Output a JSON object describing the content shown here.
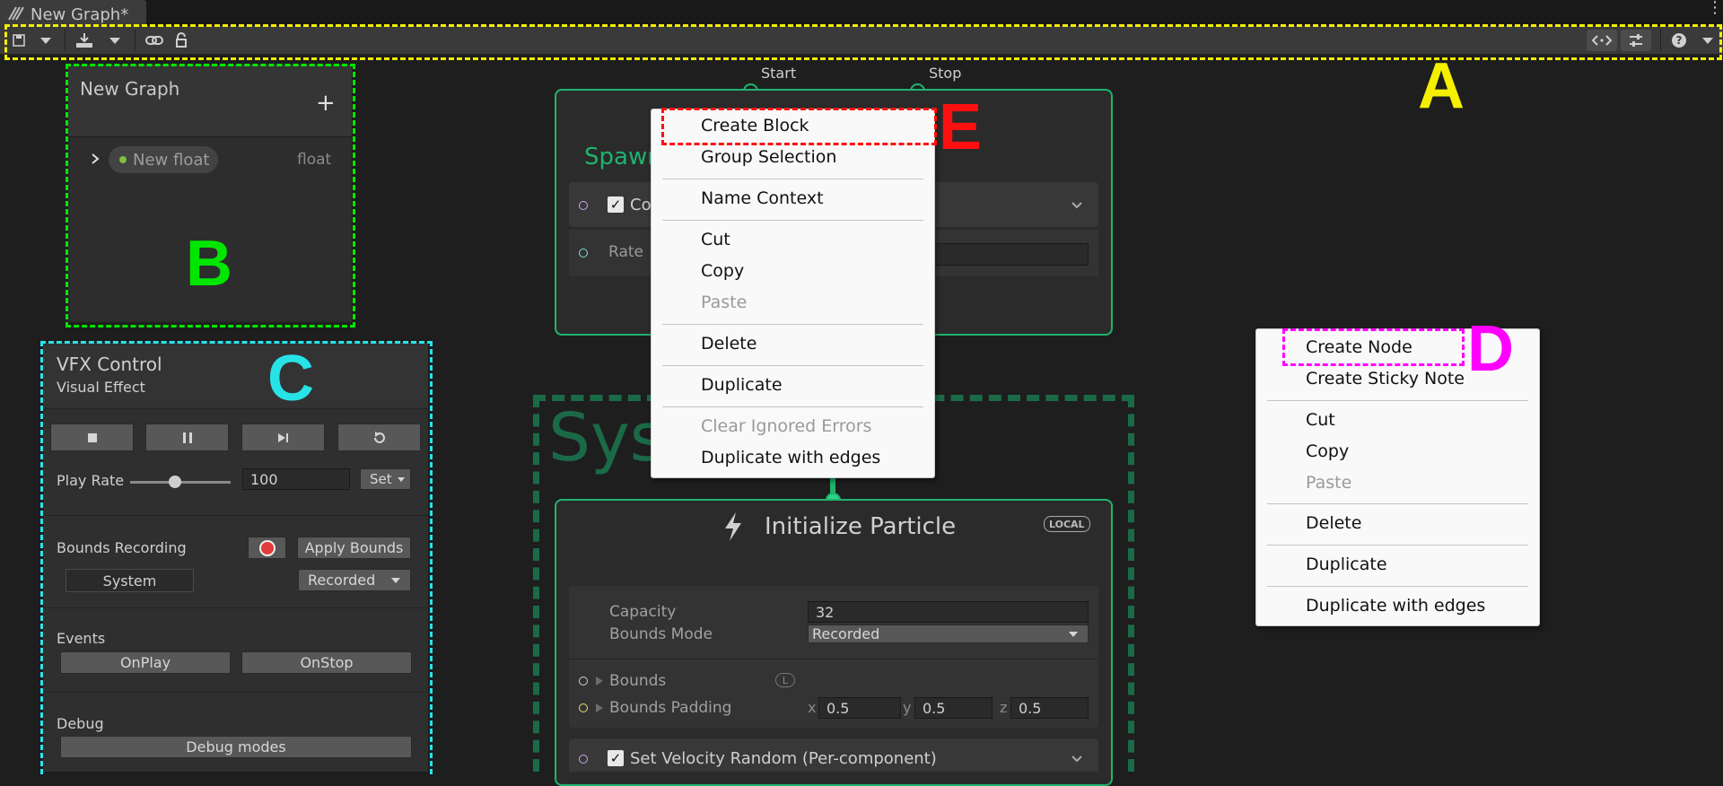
{
  "window": {
    "tab_title": "New Graph*"
  },
  "toolbar": {
    "icons": [
      "save-icon",
      "dropdown-icon",
      "import-icon",
      "dropdown-icon",
      "link-icon",
      "lock-icon",
      "code-toggle-icon",
      "settings-sliders-icon",
      "help-icon",
      "dropdown-icon"
    ]
  },
  "blackboard": {
    "title": "New Graph",
    "add_label": "+",
    "property": {
      "name": "New float",
      "type": "float"
    }
  },
  "vfx_control": {
    "title": "VFX Control",
    "subtitle": "Visual Effect",
    "play_rate_label": "Play Rate",
    "play_rate_value": "100",
    "play_rate_fraction": 0.45,
    "set_label": "Set",
    "bounds_recording_label": "Bounds Recording",
    "apply_bounds_label": "Apply Bounds",
    "system_label": "System",
    "recorded_label": "Recorded",
    "events_label": "Events",
    "onplay_label": "OnPlay",
    "onstop_label": "OnStop",
    "debug_label": "Debug",
    "debug_modes_label": "Debug modes"
  },
  "spawn_context": {
    "start_label": "Start",
    "stop_label": "Stop",
    "title_partial": "Spawn",
    "block_label_partial": "Co",
    "rate_label": "Rate"
  },
  "system": {
    "label_partial": "Sys"
  },
  "init_context": {
    "title": "Initialize Particle",
    "badge": "LOCAL",
    "capacity_label": "Capacity",
    "capacity_value": "32",
    "bounds_mode_label": "Bounds Mode",
    "bounds_mode_value": "Recorded",
    "bounds_label": "Bounds",
    "bounds_badge": "L",
    "bounds_padding_label": "Bounds Padding",
    "padding": {
      "x_label": "x",
      "x": "0.5",
      "y_label": "y",
      "y": "0.5",
      "z_label": "z",
      "z": "0.5"
    },
    "velocity_block": "Set Velocity Random (Per-component)"
  },
  "context_menu_e": {
    "items": [
      {
        "label": "Create Block",
        "disabled": false
      },
      {
        "label": "Group Selection",
        "disabled": false
      },
      {
        "label": "Name Context",
        "disabled": false
      },
      {
        "label": "Cut",
        "disabled": false
      },
      {
        "label": "Copy",
        "disabled": false
      },
      {
        "label": "Paste",
        "disabled": true
      },
      {
        "label": "Delete",
        "disabled": false
      },
      {
        "label": "Duplicate",
        "disabled": false
      },
      {
        "label": "Clear Ignored Errors",
        "disabled": true
      },
      {
        "label": "Duplicate with edges",
        "disabled": false
      }
    ]
  },
  "context_menu_d": {
    "items": [
      {
        "label": "Create Node",
        "disabled": false
      },
      {
        "label": "Create Sticky Note",
        "disabled": false
      },
      {
        "label": "Cut",
        "disabled": false
      },
      {
        "label": "Copy",
        "disabled": false
      },
      {
        "label": "Paste",
        "disabled": true
      },
      {
        "label": "Delete",
        "disabled": false
      },
      {
        "label": "Duplicate",
        "disabled": false
      },
      {
        "label": "Duplicate with edges",
        "disabled": false
      }
    ]
  },
  "annotations": {
    "a": "A",
    "b": "B",
    "c": "C",
    "d": "D",
    "e": "E"
  },
  "colors": {
    "context_border": "#1fb36e",
    "marker_a": "#f4f000",
    "marker_b": "#00e600",
    "marker_c": "#27e3e8",
    "marker_d": "#ff00ff",
    "marker_e": "#ff1010"
  }
}
